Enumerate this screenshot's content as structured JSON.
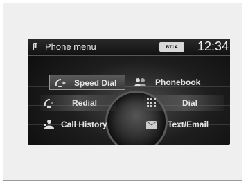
{
  "status_bar": {
    "title": "Phone menu",
    "bluetooth_badge": "ʙᴛ↑ᴀ",
    "clock": "12:34"
  },
  "menu": {
    "speed_dial": "Speed Dial",
    "phonebook": "Phonebook",
    "redial": "Redial",
    "dial": "Dial",
    "call_history": "Call History",
    "text_email": "Text/Email"
  },
  "icons": {
    "phone": "phone-icon",
    "speed_dial": "speed-dial-icon",
    "phonebook": "phonebook-icon",
    "redial": "redial-icon",
    "dial": "keypad-icon",
    "call_history": "call-history-icon",
    "text_email": "envelope-icon"
  },
  "colors": {
    "screen_bg": "#0a0a0a",
    "text": "#e4e4e4",
    "selected_bg": "#4a4a4a"
  }
}
